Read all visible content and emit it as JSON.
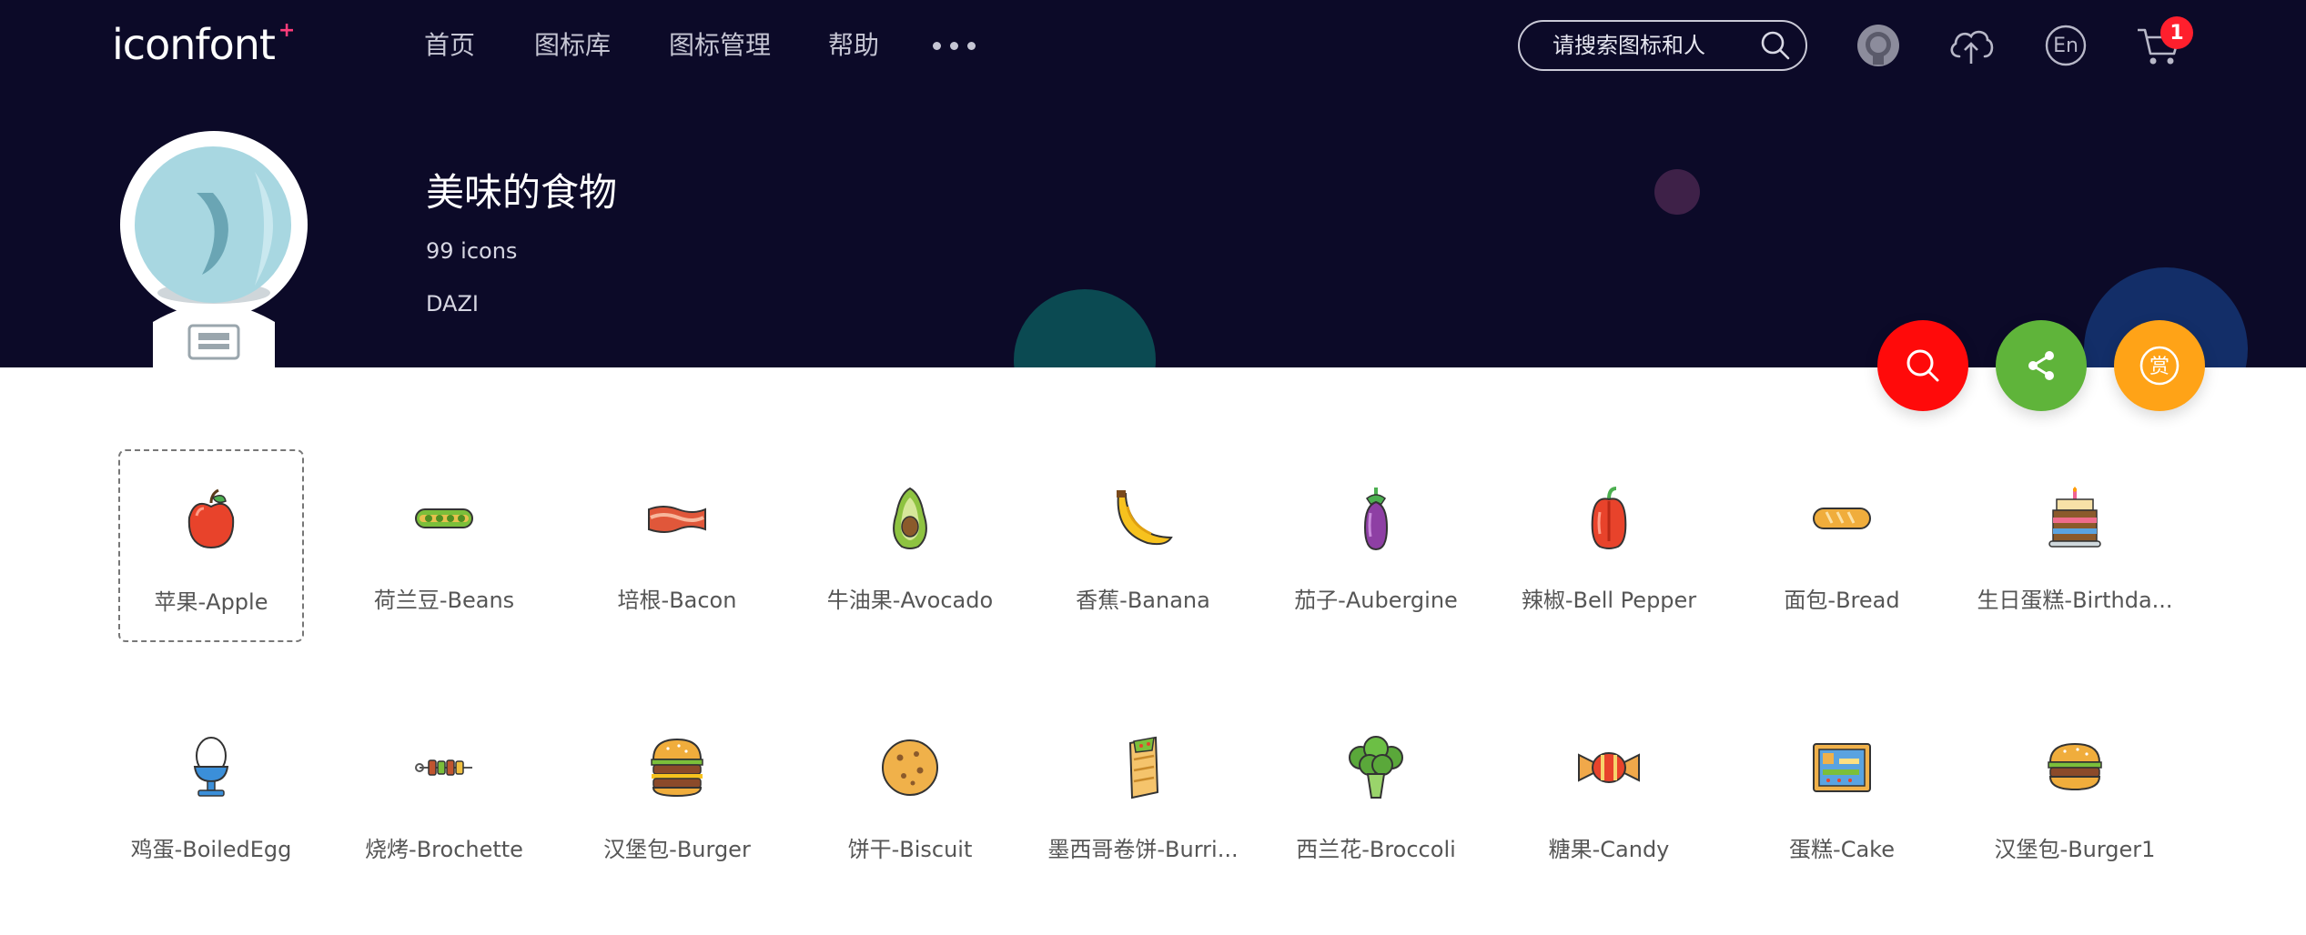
{
  "header": {
    "logo": "iconfont",
    "logo_plus": "+",
    "nav": [
      "首页",
      "图标库",
      "图标管理",
      "帮助"
    ],
    "search_placeholder": "请搜索图标和人",
    "cart_count": "1",
    "lang": "En"
  },
  "collection": {
    "title": "美味的食物",
    "count": "99 icons",
    "author": "DAZI"
  },
  "icons": [
    {
      "label": "苹果-Apple",
      "icon": "apple-icon"
    },
    {
      "label": "荷兰豆-Beans",
      "icon": "beans-icon"
    },
    {
      "label": "培根-Bacon",
      "icon": "bacon-icon"
    },
    {
      "label": "牛油果-Avocado",
      "icon": "avocado-icon"
    },
    {
      "label": "香蕉-Banana",
      "icon": "banana-icon"
    },
    {
      "label": "茄子-Aubergine",
      "icon": "aubergine-icon"
    },
    {
      "label": "辣椒-Bell Pepper",
      "icon": "bell-pepper-icon"
    },
    {
      "label": "面包-Bread",
      "icon": "bread-icon"
    },
    {
      "label": "生日蛋糕-Birthda...",
      "icon": "birthday-cake-icon"
    },
    {
      "label": "鸡蛋-BoiledEgg",
      "icon": "boiled-egg-icon"
    },
    {
      "label": "烧烤-Brochette",
      "icon": "brochette-icon"
    },
    {
      "label": "汉堡包-Burger",
      "icon": "burger-icon"
    },
    {
      "label": "饼干-Biscuit",
      "icon": "biscuit-icon"
    },
    {
      "label": "墨西哥卷饼-Burri...",
      "icon": "burrito-icon"
    },
    {
      "label": "西兰花-Broccoli",
      "icon": "broccoli-icon"
    },
    {
      "label": "糖果-Candy",
      "icon": "candy-icon"
    },
    {
      "label": "蛋糕-Cake",
      "icon": "cake-icon"
    },
    {
      "label": "汉堡包-Burger1",
      "icon": "burger1-icon"
    }
  ],
  "colors": {
    "header_bg": "#0c0a28",
    "fab_search": "#ff0a0a",
    "fab_share": "#5fb43a",
    "fab_reward": "#ffa317",
    "badge": "#ff1f2d"
  }
}
